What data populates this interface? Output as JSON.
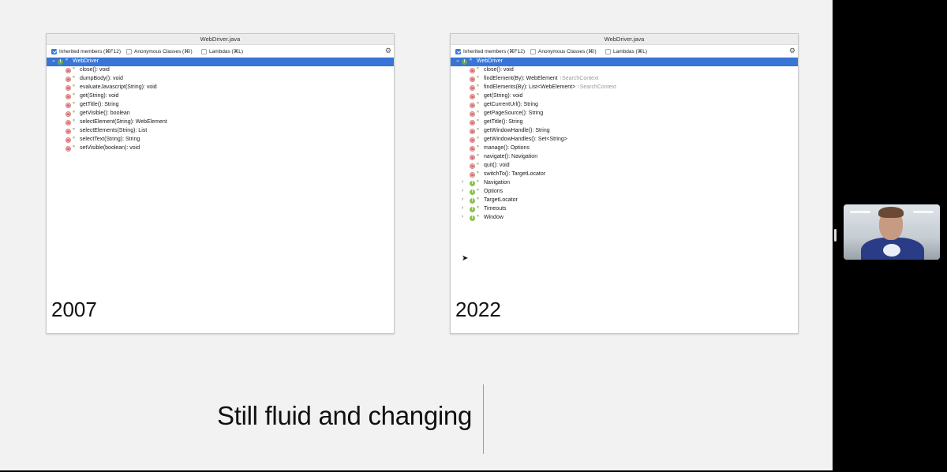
{
  "left_panel": {
    "title": "WebDriver.java",
    "options": {
      "inherited": "Inherited members (⌘F12)",
      "anonymous": "Anonymous Classes (⌘I)",
      "lambdas": "Lambdas (⌘L)"
    },
    "root": "WebDriver",
    "methods": [
      "close(): void",
      "dumpBody(): void",
      "evaluateJavascript(String): void",
      "get(String): void",
      "getTitle(): String",
      "getVisible(): boolean",
      "selectElement(String): WebElement",
      "selectElements(String): List",
      "selectText(String): String",
      "setVisible(boolean): void"
    ],
    "year": "2007"
  },
  "right_panel": {
    "title": "WebDriver.java",
    "options": {
      "inherited": "Inherited members (⌘F12)",
      "anonymous": "Anonymous Classes (⌘I)",
      "lambdas": "Lambdas (⌘L)"
    },
    "root": "WebDriver",
    "methods": [
      {
        "label": "close(): void",
        "hint": ""
      },
      {
        "label": "findElement(By): WebElement",
        "hint": "↑SearchContext"
      },
      {
        "label": "findElements(By): List<WebElement>",
        "hint": "↑SearchContext"
      },
      {
        "label": "get(String): void",
        "hint": ""
      },
      {
        "label": "getCurrentUrl(): String",
        "hint": ""
      },
      {
        "label": "getPageSource(): String",
        "hint": ""
      },
      {
        "label": "getTitle(): String",
        "hint": ""
      },
      {
        "label": "getWindowHandle(): String",
        "hint": ""
      },
      {
        "label": "getWindowHandles(): Set<String>",
        "hint": ""
      },
      {
        "label": "manage(): Options",
        "hint": ""
      },
      {
        "label": "navigate(): Navigation",
        "hint": ""
      },
      {
        "label": "quit(): void",
        "hint": ""
      },
      {
        "label": "switchTo(): TargetLocator",
        "hint": ""
      }
    ],
    "classes": [
      "Navigation",
      "Options",
      "TargetLocator",
      "Timeouts",
      "Window"
    ],
    "year": "2022"
  },
  "caption": "Still fluid and changing",
  "icons": {
    "method": "m",
    "interface": "I",
    "class_nested": "I",
    "gear": "⚙"
  }
}
